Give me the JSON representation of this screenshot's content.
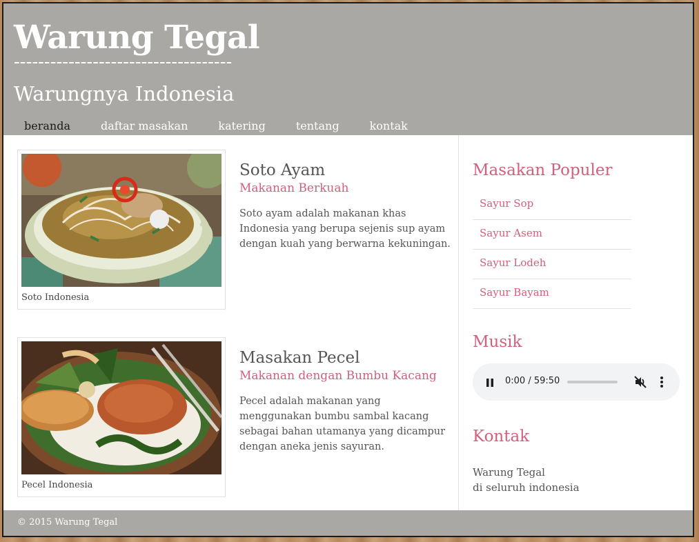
{
  "header": {
    "site_title": "Warung Tegal",
    "title_rule": "------------------------------------",
    "tagline": "Warungnya Indonesia"
  },
  "nav": {
    "items": [
      {
        "label": "beranda",
        "active": true
      },
      {
        "label": "daftar masakan",
        "active": false
      },
      {
        "label": "katering",
        "active": false
      },
      {
        "label": "tentang",
        "active": false
      },
      {
        "label": "kontak",
        "active": false
      }
    ]
  },
  "articles": [
    {
      "caption": "Soto Indonesia",
      "title": "Soto Ayam",
      "subtitle": "Makanan Berkuah",
      "body": "Soto ayam adalah makanan khas Indonesia yang berupa sejenis sup ayam dengan kuah yang berwarna kekuningan."
    },
    {
      "caption": "Pecel Indonesia",
      "title": "Masakan Pecel",
      "subtitle": "Makanan dengan Bumbu Kacang",
      "body": "Pecel adalah makanan yang menggunakan bumbu sambal kacang sebagai bahan utamanya yang dicampur dengan aneka jenis sayuran."
    }
  ],
  "sidebar": {
    "popular": {
      "heading": "Masakan Populer",
      "items": [
        "Sayur Sop",
        "Sayur Asem",
        "Sayur Lodeh",
        "Sayur Bayam"
      ]
    },
    "music": {
      "heading": "Musik",
      "time": "0:00 / 59:50",
      "progress": 0,
      "muted": true
    },
    "contact": {
      "heading": "Kontak",
      "line1": "Warung Tegal",
      "line2": "di seluruh indonesia"
    }
  },
  "footer": {
    "text": "© 2015 Warung Tegal"
  },
  "colors": {
    "accent": "#d2607c",
    "header_bg": "#a9a8a4",
    "text": "#555555"
  }
}
